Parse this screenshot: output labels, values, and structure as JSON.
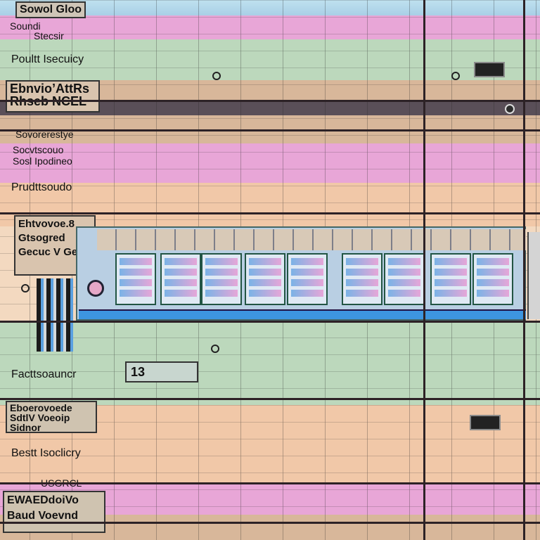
{
  "header": {
    "title_line1": "Sowol Gloo",
    "title_line2": "Soundi",
    "title_line3": "Stecsir"
  },
  "rows": [
    {
      "label": "Poultt Isecuicy"
    },
    {
      "label": "Prudttsoudo"
    },
    {
      "label": "Facttsoauncr"
    },
    {
      "label": "Bestt Isoclicry"
    }
  ],
  "boxes": {
    "box_a_line1": "Ebnvio’AttRs",
    "box_a_line2": "Rhseb NCEL",
    "box_b_line1": "Ehtvovoe.8",
    "box_b_line2": "Gtsogred",
    "box_b_line3": "Gecuc V Gea",
    "box_c_line1": "Eboerovoede",
    "box_c_line2": "SdtlV Voeoip",
    "box_c_line3": "Sidnor",
    "box_d_line1": "USGRCL",
    "box_d_line2": "EWAEDdoiVo",
    "box_d_line3": "Baud Voevnd"
  },
  "mid": {
    "label_line1": "Sovorerestye",
    "label_line2": "Socvtscouo",
    "label_line3": "Sosl Ipodineo"
  },
  "value": "13",
  "colors": {
    "pink": "#e8a6d7",
    "green": "#bcd8bc",
    "peach": "#f1c8a8",
    "blue": "#3d95e0"
  }
}
